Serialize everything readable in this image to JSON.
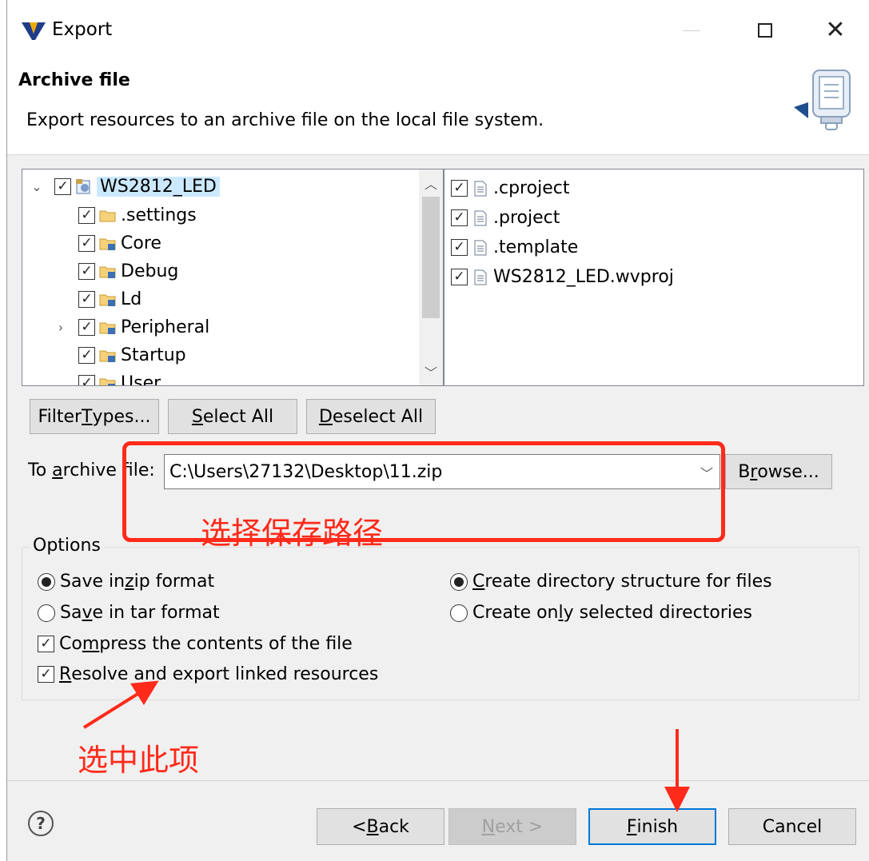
{
  "window": {
    "title": "Export"
  },
  "banner": {
    "title": "Archive file",
    "description": "Export resources to an archive file on the local file system."
  },
  "resources_tree": [
    {
      "label": "WS2812_LED",
      "checked": true,
      "expanded": true,
      "type": "project"
    },
    {
      "label": ".settings",
      "checked": true,
      "type": "folder"
    },
    {
      "label": "Core",
      "checked": true,
      "type": "linked-folder"
    },
    {
      "label": "Debug",
      "checked": true,
      "type": "linked-folder"
    },
    {
      "label": "Ld",
      "checked": true,
      "type": "linked-folder"
    },
    {
      "label": "Peripheral",
      "checked": true,
      "type": "linked-folder",
      "collapsed": true
    },
    {
      "label": "Startup",
      "checked": true,
      "type": "linked-folder"
    },
    {
      "label": "User",
      "checked": true,
      "type": "linked-folder"
    }
  ],
  "files_list": [
    {
      "label": ".cproject",
      "checked": true
    },
    {
      "label": ".project",
      "checked": true
    },
    {
      "label": ".template",
      "checked": true
    },
    {
      "label": "WS2812_LED.wvproj",
      "checked": true
    }
  ],
  "selection_buttons": {
    "filter_types": {
      "pre": "Filter ",
      "ul": "T",
      "post": "ypes..."
    },
    "select_all": {
      "pre": "",
      "ul": "S",
      "post": "elect All"
    },
    "deselect_all": {
      "pre": "",
      "ul": "D",
      "post": "eselect All"
    }
  },
  "archive": {
    "label": {
      "pre": "To ",
      "ul": "a",
      "post": "rchive file:"
    },
    "value": "C:\\Users\\27132\\Desktop\\11.zip",
    "browse": {
      "pre": "B",
      "ul": "r",
      "post": "owse..."
    }
  },
  "options": {
    "legend": "Options",
    "save_zip": {
      "pre": "Save in ",
      "ul": "z",
      "post": "ip format",
      "selected": true
    },
    "save_tar": {
      "pre": "Sa",
      "ul": "v",
      "post": "e in tar format",
      "selected": false
    },
    "compress": {
      "pre": "Co",
      "ul": "m",
      "post": "press the contents of the file",
      "checked": true
    },
    "resolve_linked": {
      "pre": "",
      "ul": "R",
      "post": "esolve and export linked resources",
      "checked": true
    },
    "create_structure": {
      "pre": "",
      "ul": "C",
      "post": "reate directory structure for files",
      "selected": true
    },
    "create_selected_only": {
      "pre": "Create on",
      "ul": "l",
      "post": "y selected directories",
      "selected": false
    }
  },
  "footer": {
    "help": "?",
    "back": {
      "pre": "< ",
      "ul": "B",
      "post": "ack"
    },
    "next": {
      "pre": "",
      "ul": "N",
      "post": "ext >"
    },
    "finish": {
      "pre": "",
      "ul": "F",
      "post": "inish"
    },
    "cancel": "Cancel"
  },
  "annotations": {
    "choose_path": "选择保存路径",
    "select_option": "选中此项",
    "color": "#ff2a1a"
  }
}
